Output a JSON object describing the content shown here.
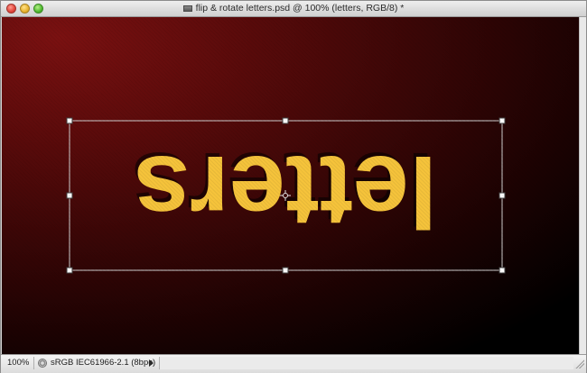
{
  "window": {
    "title": "flip & rotate letters.psd @ 100% (letters, RGB/8) *"
  },
  "canvas": {
    "layer_text": "letters",
    "text_color": "#f5c33b",
    "transform": "flipped-horizontal-and-vertical"
  },
  "statusbar": {
    "zoom": "100%",
    "doc_info": "sRGB IEC61966-2.1 (8bpc)"
  },
  "colors": {
    "background_dark_red": "#6b0f0f",
    "text_gold": "#f5c33b",
    "bbox_stroke": "#cfcfcf"
  }
}
